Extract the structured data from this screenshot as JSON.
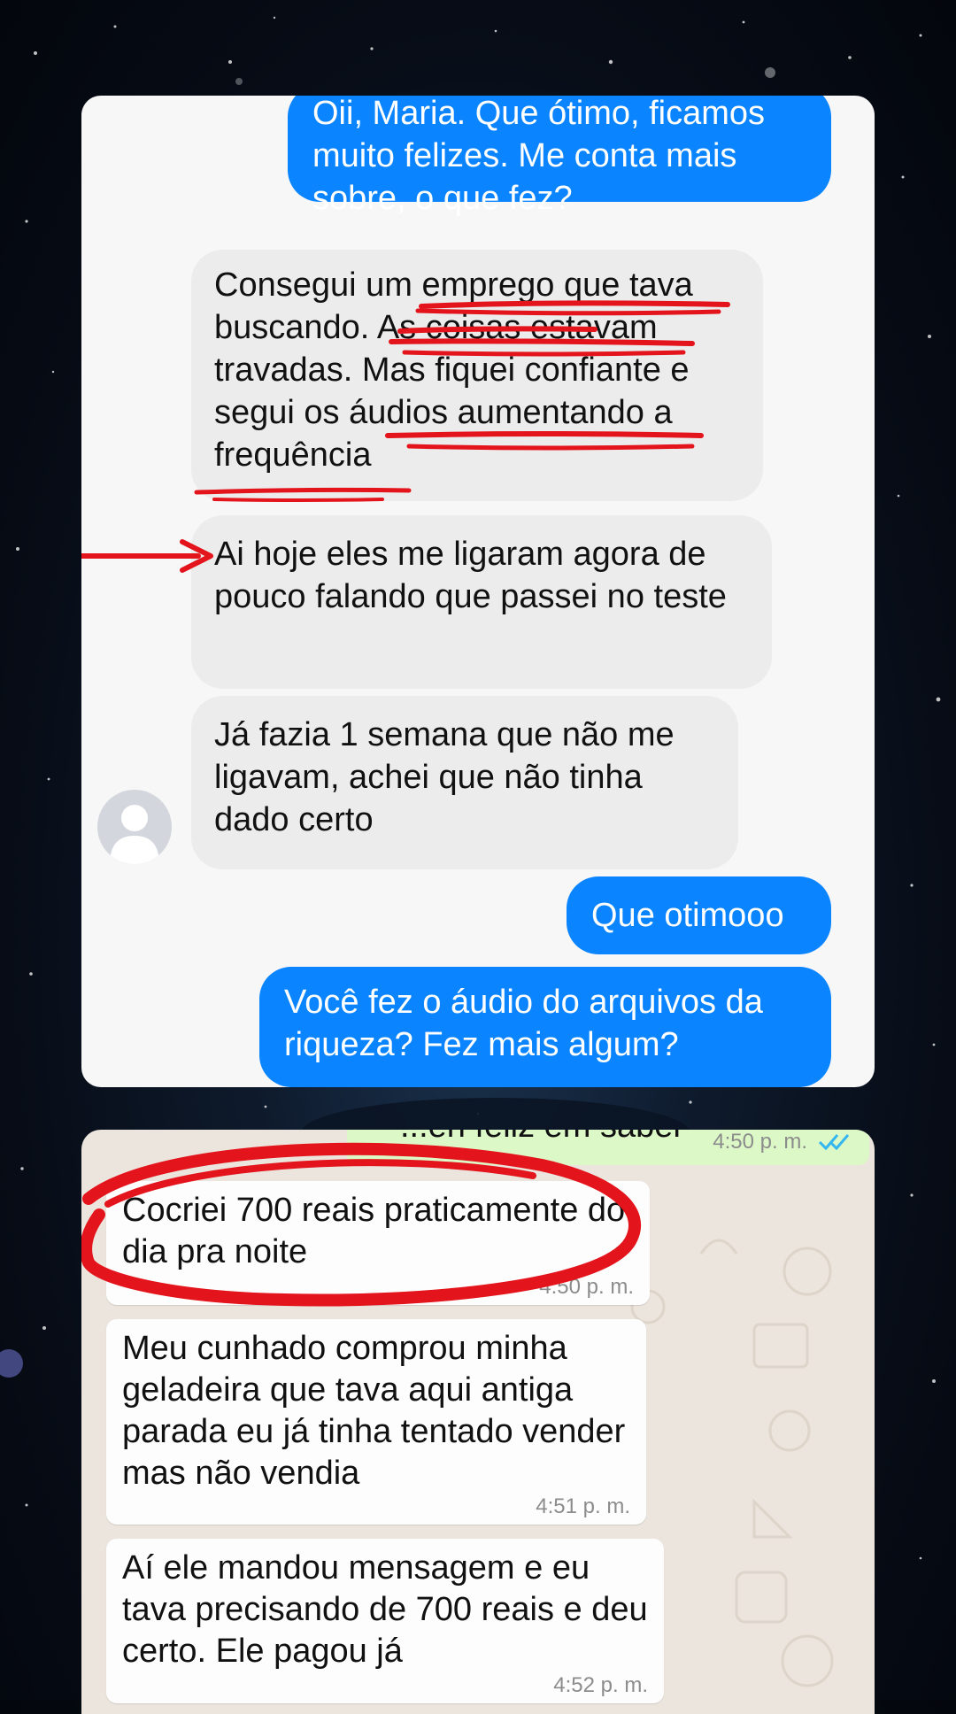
{
  "chat_top": {
    "messages": [
      {
        "dir": "out",
        "text": "Oii, Maria. Que ótimo, ficamos muito felizes. Me conta mais sobre, o que fez?"
      },
      {
        "dir": "in",
        "text": "Consegui um emprego que tava buscando. As coisas estavam travadas. Mas fiquei confiante e segui os áudios aumentando a frequência"
      },
      {
        "dir": "in",
        "text": "Ai hoje eles me ligaram agora de pouco falando que passei no teste"
      },
      {
        "dir": "in",
        "text": "Já fazia 1 semana que não me ligavam, achei que não tinha dado certo"
      },
      {
        "dir": "out",
        "text": "Que otimooo"
      },
      {
        "dir": "out",
        "text": "Você fez o áudio do arquivos da riqueza? Fez mais algum?"
      }
    ]
  },
  "chat_bottom": {
    "partial_out": {
      "text": "...en feliz em saber",
      "time": "4:50 p. m."
    },
    "messages": [
      {
        "text": "Cocriei 700 reais praticamente do dia pra noite",
        "time": "4:50 p. m."
      },
      {
        "text": "Meu cunhado comprou minha geladeira que tava aqui antiga parada eu já tinha tentado vender mas não vendia",
        "time": "4:51 p. m."
      },
      {
        "text": "Aí ele mandou mensagem e eu tava precisando de 700 reais e deu certo. Ele pagou já",
        "time": "4:52 p. m."
      }
    ]
  },
  "colors": {
    "imessage_blue": "#0b84ff",
    "received_gray": "#ececec",
    "whatsapp_bg": "#ece5dd",
    "whatsapp_out": "#dcf8c6",
    "annotation_red": "#e3141b",
    "read_ticks": "#34b7f1"
  },
  "icons": [
    "avatar-placeholder-icon",
    "double-check-icon",
    "red-arrow-annotation",
    "red-circle-annotation",
    "red-underline-annotation"
  ]
}
